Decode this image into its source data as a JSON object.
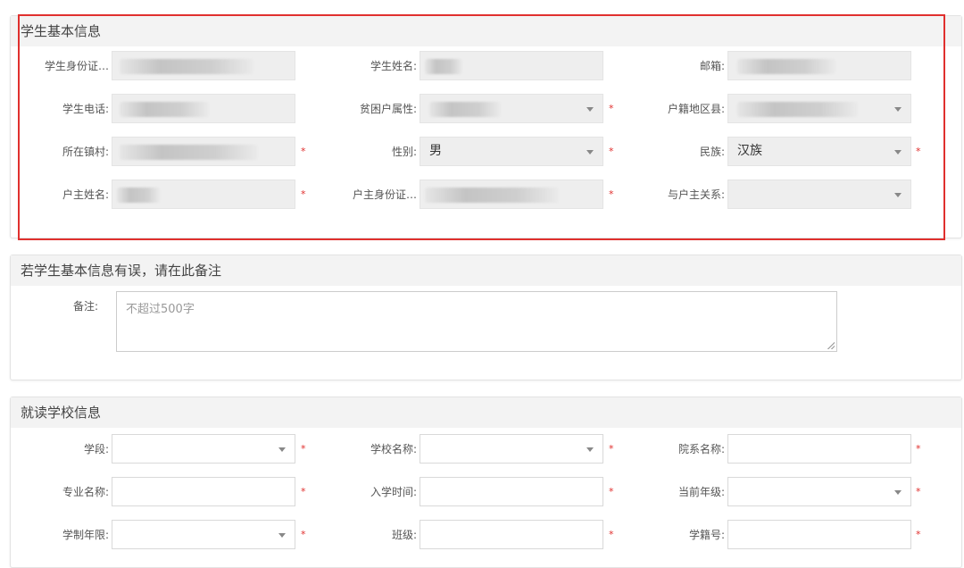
{
  "basic_info": {
    "title": "学生基本信息",
    "fields": {
      "id_number": {
        "label": "学生身份证…",
        "value": ""
      },
      "student_name": {
        "label": "学生姓名:",
        "value": ""
      },
      "email": {
        "label": "邮箱:",
        "value": ""
      },
      "phone": {
        "label": "学生电话:",
        "value": ""
      },
      "poverty_attr": {
        "label": "贫困户属性:",
        "value": ""
      },
      "household_region": {
        "label": "户籍地区县:",
        "value": ""
      },
      "town_village": {
        "label": "所在镇村:",
        "value": ""
      },
      "gender": {
        "label": "性别:",
        "value": "男"
      },
      "ethnicity": {
        "label": "民族:",
        "value": "汉族"
      },
      "householder_name": {
        "label": "户主姓名:",
        "value": ""
      },
      "householder_id": {
        "label": "户主身份证…",
        "value": ""
      },
      "relation": {
        "label": "与户主关系:",
        "value": ""
      }
    },
    "required_mark": "*"
  },
  "remark": {
    "title": "若学生基本信息有误，请在此备注",
    "label": "备注:",
    "placeholder": "不超过500字"
  },
  "school_info": {
    "title": "就读学校信息",
    "fields": {
      "stage": {
        "label": "学段:",
        "value": ""
      },
      "school_name": {
        "label": "学校名称:",
        "value": ""
      },
      "department": {
        "label": "院系名称:",
        "value": ""
      },
      "major": {
        "label": "专业名称:",
        "value": ""
      },
      "enroll_time": {
        "label": "入学时间:",
        "value": ""
      },
      "grade": {
        "label": "当前年级:",
        "value": ""
      },
      "duration": {
        "label": "学制年限:",
        "value": ""
      },
      "class": {
        "label": "班级:",
        "value": ""
      },
      "student_no": {
        "label": "学籍号:",
        "value": ""
      }
    }
  },
  "colors": {
    "required": "#e0302e",
    "highlight": "#e0302e",
    "readonly_bg": "#eeeeee"
  }
}
